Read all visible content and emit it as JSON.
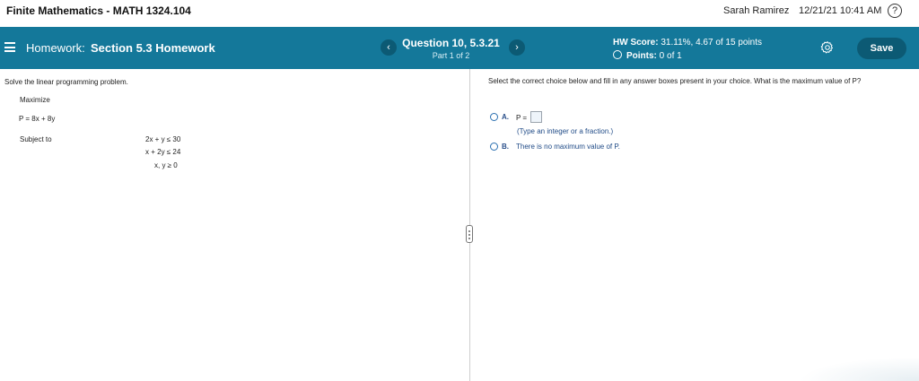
{
  "topbar": {
    "course_title": "Finite Mathematics - MATH 1324.104",
    "user_name": "Sarah Ramirez",
    "datetime": "12/21/21 10:41 AM",
    "help_icon": "question-circle-icon",
    "help_glyph": "?"
  },
  "header": {
    "menu_icon": "hamburger-menu-icon",
    "homework_prefix": "Homework:",
    "homework_section": "Section 5.3 Homework",
    "prev_glyph": "‹",
    "next_glyph": "›",
    "question_title": "Question 10, 5.3.21",
    "question_part": "Part 1 of 2",
    "hw_score_label": "HW Score:",
    "hw_score_value": "31.11%, 4.67 of 15 points",
    "points_label": "Points:",
    "points_value": "0 of 1",
    "settings_icon": "gear-icon",
    "save_label": "Save",
    "colors": {
      "header_bg": "#14789a",
      "button_bg": "#0c5a74"
    }
  },
  "problem": {
    "instruction": "Solve the linear programming problem.",
    "maximize_label": "Maximize",
    "objective": "P = 8x + 8y",
    "subject_label": "Subject to",
    "constraints": [
      "2x + y  ≤  30",
      "x + 2y  ≤  24",
      "x, y  ≥  0"
    ]
  },
  "answer": {
    "prompt": "Select the correct choice below and fill in any answer boxes present in your choice.  What is the maximum value of P?",
    "option_a_letter": "A.",
    "option_a_text": "P =",
    "option_a_hint": "(Type an integer or a fraction.)",
    "option_b_letter": "B.",
    "option_b_text": "There is no maximum value of P."
  }
}
